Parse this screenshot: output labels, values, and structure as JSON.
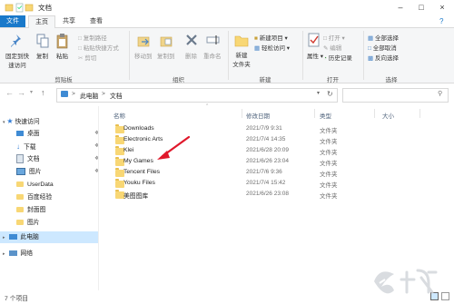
{
  "window": {
    "title": "文档"
  },
  "tabs": [
    "文件",
    "主页",
    "共享",
    "查看"
  ],
  "ribbon": {
    "clipboard": {
      "pin_label_1": "固定到快",
      "pin_label_2": "速访问",
      "copy_label": "复制",
      "paste_label": "粘贴",
      "copy_path": "复制路径",
      "paste_shortcut": "粘贴快捷方式",
      "cut": "剪切",
      "group_label": "剪贴板"
    },
    "organize": {
      "move_to": "移动到",
      "copy_to": "复制到",
      "delete": "删除",
      "rename": "重命名",
      "group_label": "组织"
    },
    "new": {
      "new_folder_1": "新建",
      "new_folder_2": "文件夹",
      "new_item": "新建项目",
      "easy_access": "轻松访问",
      "group_label": "新建"
    },
    "open": {
      "properties": "属性",
      "open": "打开",
      "edit": "编辑",
      "history": "历史记录",
      "group_label": "打开"
    },
    "select": {
      "select_all": "全部选择",
      "select_none": "全部取消",
      "invert": "反向选择",
      "group_label": "选择"
    }
  },
  "address": {
    "crumbs": [
      "此电脑",
      "文档"
    ],
    "sep": ">"
  },
  "nav": {
    "quick_access": "快速访问",
    "items": [
      "桌面",
      "下载",
      "文档",
      "图片",
      "UserData",
      "百度经验",
      "封面图",
      "图片"
    ],
    "this_pc": "此电脑",
    "network": "网络"
  },
  "columns": {
    "name": "名称",
    "date": "修改日期",
    "type": "类型",
    "size": "大小"
  },
  "files": [
    {
      "name": "Downloads",
      "date": "2021/7/9 9:31",
      "type": "文件夹"
    },
    {
      "name": "Electronic Arts",
      "date": "2021/7/4 14:35",
      "type": "文件夹"
    },
    {
      "name": "Klei",
      "date": "2021/6/28 20:09",
      "type": "文件夹"
    },
    {
      "name": "My Games",
      "date": "2021/6/26 23:04",
      "type": "文件夹"
    },
    {
      "name": "Tencent Files",
      "date": "2021/7/6 9:36",
      "type": "文件夹"
    },
    {
      "name": "Youku Files",
      "date": "2021/7/4 15:42",
      "type": "文件夹"
    },
    {
      "name": "美图图库",
      "date": "2021/6/26 23:08",
      "type": "文件夹"
    }
  ],
  "status": {
    "count": "7 个项目"
  },
  "watermark": "九游",
  "colors": {
    "accent": "#1979ca",
    "folder": "#f8d775",
    "selection": "#cde8ff",
    "arrow": "#e0182b"
  }
}
